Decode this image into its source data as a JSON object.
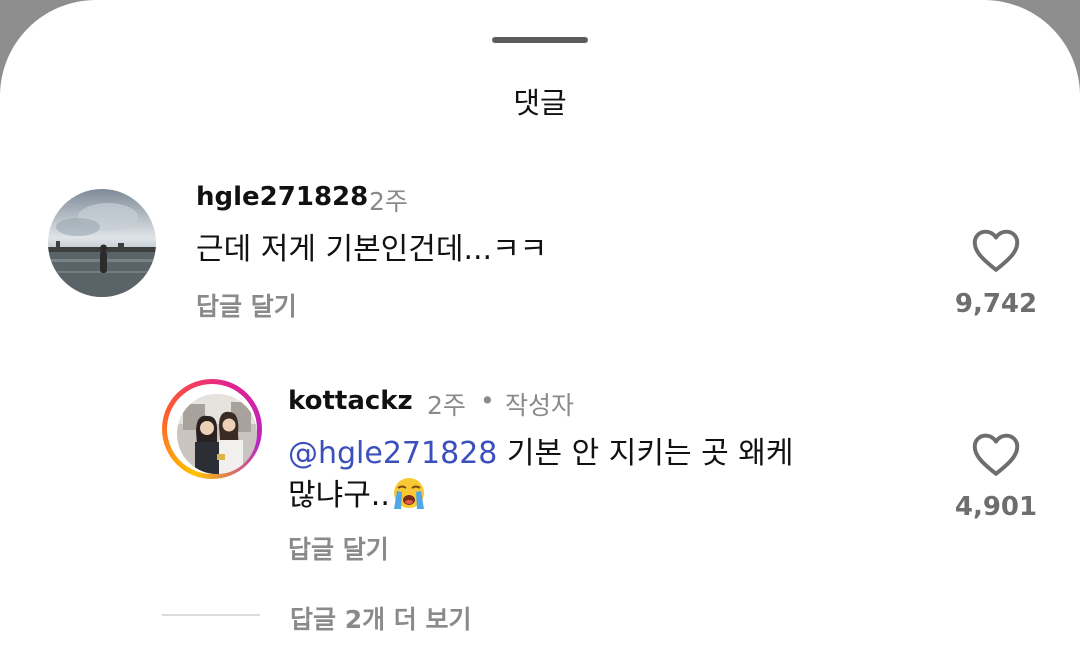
{
  "sheet": {
    "title": "댓글"
  },
  "comment": {
    "username": "hgle271828",
    "time": "2주",
    "text": "근데 저게 기본인건데...ㅋㅋ",
    "reply_label": "답글 달기",
    "likes": "9,742"
  },
  "reply": {
    "username": "kottackz",
    "time": "2주",
    "separator": "•",
    "author_badge": "작성자",
    "mention": "@hgle271828",
    "text_line1": " 기본 안 지키는 곳 왜케",
    "text_line2": "많냐구..",
    "reply_label": "답글 달기",
    "likes": "4,901"
  },
  "more_replies": "답글 2개 더 보기"
}
